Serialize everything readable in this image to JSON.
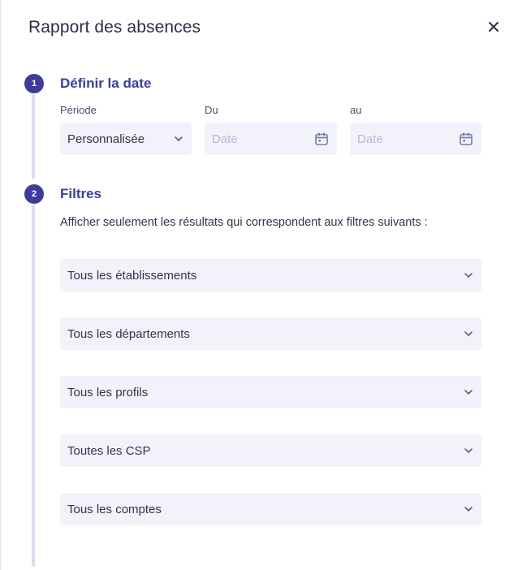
{
  "header": {
    "title": "Rapport des absences"
  },
  "close_icon": "close-icon",
  "steps": [
    {
      "number": "1",
      "title": "Définir la date"
    },
    {
      "number": "2",
      "title": "Filtres"
    }
  ],
  "date_section": {
    "period_label": "Période",
    "period_value": "Personnalisée",
    "from_label": "Du",
    "from_placeholder": "Date",
    "to_label": "au",
    "to_placeholder": "Date"
  },
  "filters_section": {
    "help_text": "Afficher seulement les résultats qui correspondent aux filtres suivants :",
    "filters": [
      "Tous les établissements",
      "Tous les départements",
      "Tous les profils",
      "Toutes les CSP",
      "Tous les comptes"
    ]
  },
  "colors": {
    "accent": "#3d3d99",
    "field_bg": "#f2f2fb",
    "rail": "#dcdcf2",
    "placeholder": "#b8b8d6"
  }
}
